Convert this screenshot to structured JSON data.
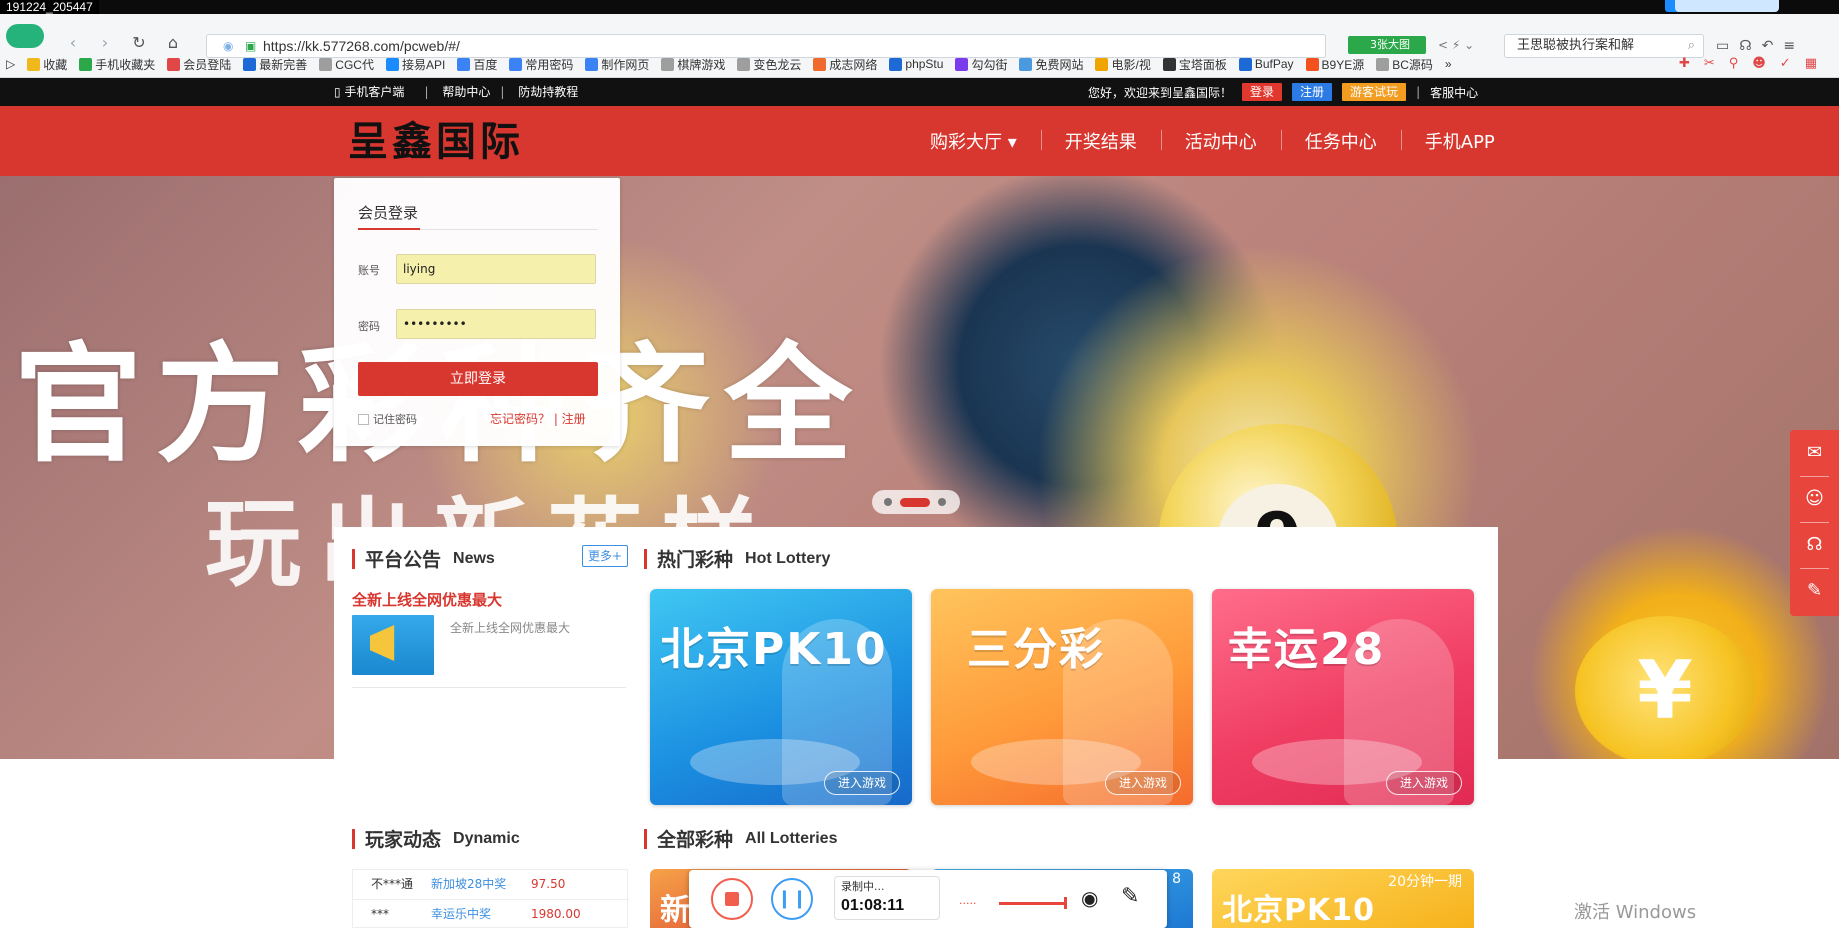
{
  "recording_stamp": "191224_205447",
  "browser": {
    "url": "https://kk.577268.com/pcweb/#/",
    "addr_ext_label": "3张大图",
    "search_text": "王思聪被执行案和解",
    "bookmarks": [
      "收藏",
      "手机收藏夹",
      "会员登陆",
      "最新完善",
      "CGC代",
      "接易API",
      "百度",
      "常用密码",
      "制作网页",
      "棋牌游戏",
      "变色龙云",
      "成志网络",
      "phpStu",
      "勾勾街",
      "免费网站",
      "电影/视",
      "宝塔面板",
      "BufPay",
      "B9YE源",
      "BC源码"
    ],
    "bookmark_colors": [
      "#f1b81b",
      "#2ba84a",
      "#e24747",
      "#1d6ad6",
      "#9e9e9e",
      "#1a8cff",
      "#3b82f6",
      "#3b82f6",
      "#3b82f6",
      "#9e9e9e",
      "#9e9e9e",
      "#f06a2e",
      "#1d6ad6",
      "#7c3aed",
      "#4b9ae0",
      "#f0a400",
      "#333333",
      "#1d6ad6",
      "#f4511e",
      "#9e9e9e"
    ]
  },
  "site_topbar": {
    "links": [
      "手机客户端",
      "帮助中心",
      "防劫持教程"
    ],
    "welcome": "您好，欢迎来到呈鑫国际！",
    "login_label": "登录",
    "register_label": "注册",
    "trial_label": "游客试玩",
    "service_label": "客服中心"
  },
  "header": {
    "brand": "呈鑫国际",
    "nav": [
      "购彩大厅 ▾",
      "开奖结果",
      "活动中心",
      "任务中心",
      "手机APP"
    ]
  },
  "banner": {
    "headline": "官方彩种齐全",
    "subline": "玩出新花样",
    "ball_number": "9",
    "coin_symbol": "¥"
  },
  "login": {
    "title": "会员登录",
    "account_label": "账号",
    "account_value": "liying",
    "password_label": "密码",
    "password_value": "•••••••••",
    "submit_label": "立即登录",
    "remember_label": "记住密码",
    "forgot_label": "忘记密码？ | 注册"
  },
  "notice": {
    "title_cn": "平台公告",
    "title_en": "News",
    "more_label": "更多+",
    "headline": "全新上线全网优惠最大",
    "desc": "全新上线全网优惠最大"
  },
  "hot": {
    "title_cn": "热门彩种",
    "title_en": "Hot Lottery",
    "enter_label": "进入游戏",
    "cards": [
      "北京PK10",
      "三分彩",
      "幸运28"
    ]
  },
  "dynamic": {
    "title_cn": "玩家动态",
    "title_en": "Dynamic",
    "rows": [
      {
        "user": "不***通",
        "game": "新加坡28中奖",
        "amount": "97.50"
      },
      {
        "user": "***",
        "game": "幸运乐中奖",
        "amount": "1980.00"
      }
    ]
  },
  "all": {
    "title_cn": "全部彩种",
    "title_en": "All Lotteries",
    "mini_cards": [
      {
        "title": "新",
        "tag": ""
      },
      {
        "title": "",
        "tag": "8"
      },
      {
        "title": "北京PK10",
        "tag": "20分钟一期"
      }
    ]
  },
  "recorder": {
    "status": "录制中...",
    "time": "01:08:11",
    "dots": "....."
  },
  "watermark": "激活 Windows"
}
